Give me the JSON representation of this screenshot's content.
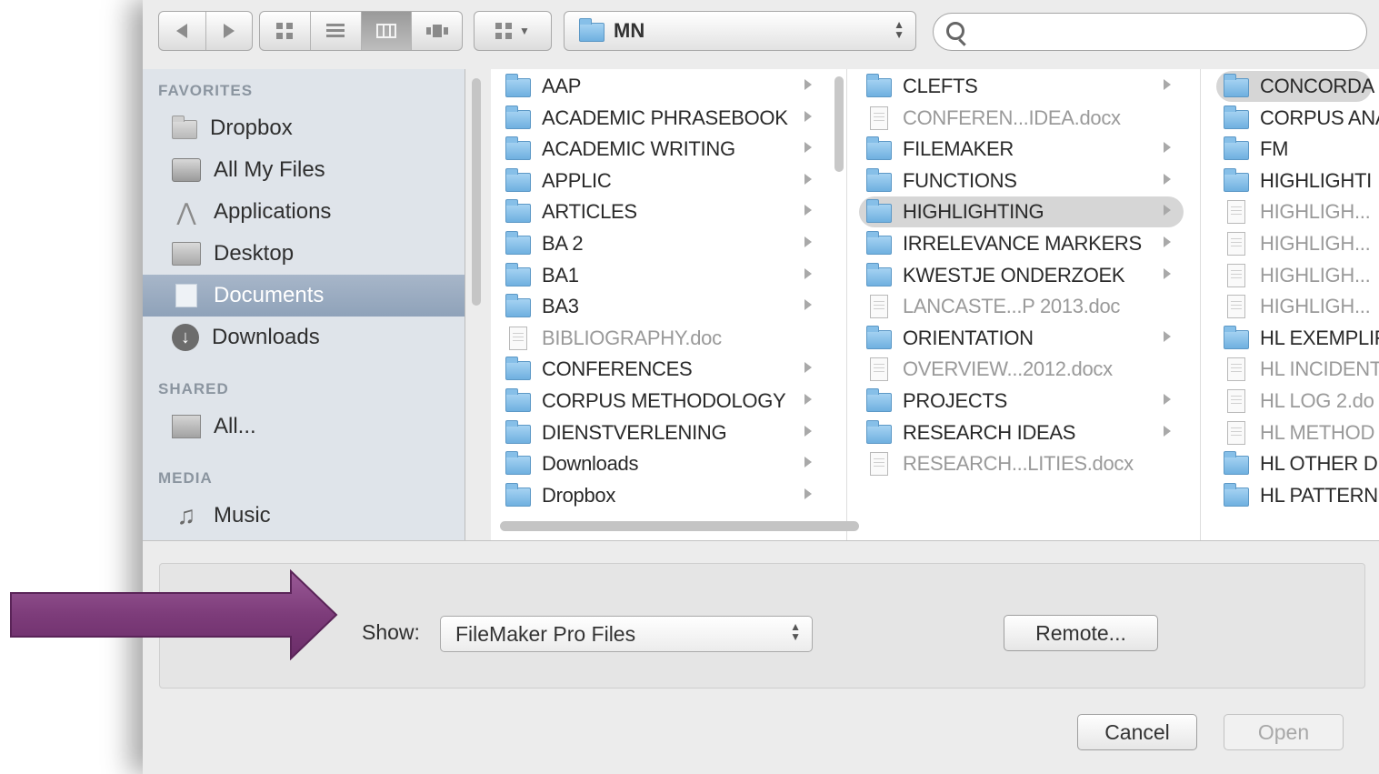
{
  "toolbar": {
    "path_label": "MN",
    "search_placeholder": ""
  },
  "sidebar": {
    "favorites_header": "FAVORITES",
    "shared_header": "SHARED",
    "media_header": "MEDIA",
    "favorites": [
      {
        "label": "Dropbox",
        "icon": "folder-icon"
      },
      {
        "label": "All My Files",
        "icon": "all-my-files-icon"
      },
      {
        "label": "Applications",
        "icon": "applications-icon"
      },
      {
        "label": "Desktop",
        "icon": "desktop-icon"
      },
      {
        "label": "Documents",
        "icon": "documents-icon",
        "selected": true
      },
      {
        "label": "Downloads",
        "icon": "downloads-icon"
      }
    ],
    "shared": [
      {
        "label": "All...",
        "icon": "network-icon"
      }
    ],
    "media": [
      {
        "label": "Music",
        "icon": "music-icon"
      }
    ]
  },
  "columns": [
    {
      "items": [
        {
          "name": "AAP",
          "type": "folder"
        },
        {
          "name": "ACADEMIC PHRASEBOOK",
          "type": "folder"
        },
        {
          "name": "ACADEMIC WRITING",
          "type": "folder"
        },
        {
          "name": "APPLIC",
          "type": "folder"
        },
        {
          "name": "ARTICLES",
          "type": "folder"
        },
        {
          "name": "BA 2",
          "type": "folder"
        },
        {
          "name": "BA1",
          "type": "folder"
        },
        {
          "name": "BA3",
          "type": "folder"
        },
        {
          "name": "BIBLIOGRAPHY.doc",
          "type": "file"
        },
        {
          "name": "CONFERENCES",
          "type": "folder"
        },
        {
          "name": "CORPUS METHODOLOGY",
          "type": "folder"
        },
        {
          "name": "DIENSTVERLENING",
          "type": "folder"
        },
        {
          "name": "Downloads",
          "type": "folder"
        },
        {
          "name": "Dropbox",
          "type": "folder"
        }
      ]
    },
    {
      "items": [
        {
          "name": "CLEFTS",
          "type": "folder"
        },
        {
          "name": "CONFEREN...IDEA.docx",
          "type": "file"
        },
        {
          "name": "FILEMAKER",
          "type": "folder"
        },
        {
          "name": "FUNCTIONS",
          "type": "folder"
        },
        {
          "name": "HIGHLIGHTING",
          "type": "folder",
          "selected": true
        },
        {
          "name": "IRRELEVANCE  MARKERS",
          "type": "folder"
        },
        {
          "name": "KWESTJE ONDERZOEK",
          "type": "folder"
        },
        {
          "name": "LANCASTE...P 2013.doc",
          "type": "file"
        },
        {
          "name": "ORIENTATION",
          "type": "folder"
        },
        {
          "name": "OVERVIEW...2012.docx",
          "type": "file"
        },
        {
          "name": "PROJECTS",
          "type": "folder"
        },
        {
          "name": "RESEARCH IDEAS",
          "type": "folder"
        },
        {
          "name": "RESEARCH...LITIES.docx",
          "type": "file"
        }
      ]
    },
    {
      "items": [
        {
          "name": "CONCORDA",
          "type": "folder",
          "selected": true
        },
        {
          "name": "CORPUS ANA",
          "type": "folder"
        },
        {
          "name": "FM",
          "type": "folder"
        },
        {
          "name": "HIGHLIGHTI",
          "type": "folder"
        },
        {
          "name": "HIGHLIGH...",
          "type": "file"
        },
        {
          "name": "HIGHLIGH...",
          "type": "file"
        },
        {
          "name": "HIGHLIGH...",
          "type": "file"
        },
        {
          "name": "HIGHLIGH...",
          "type": "file"
        },
        {
          "name": "HL EXEMPLIF",
          "type": "folder"
        },
        {
          "name": "HL INCIDENT",
          "type": "file"
        },
        {
          "name": "HL LOG 2.do",
          "type": "file"
        },
        {
          "name": "HL METHOD",
          "type": "file"
        },
        {
          "name": "HL OTHER D",
          "type": "folder"
        },
        {
          "name": "HL PATTERN",
          "type": "folder"
        }
      ]
    }
  ],
  "options": {
    "show_label": "Show:",
    "show_value": "FileMaker Pro Files",
    "remote_label": "Remote..."
  },
  "buttons": {
    "cancel": "Cancel",
    "open": "Open"
  },
  "colors": {
    "annotation_arrow": "#7d3c7a",
    "selection": "#d6d6d6",
    "sidebar_selected": "#98a9be",
    "folder": "#7fbbe6"
  }
}
